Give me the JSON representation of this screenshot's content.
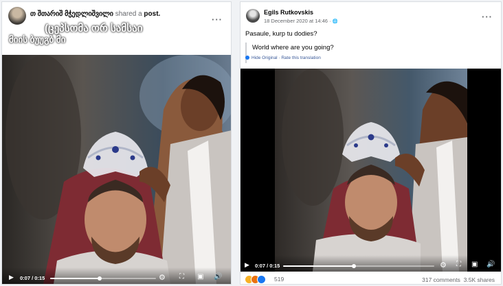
{
  "left_post": {
    "author": "თ  შთარიშ მჭედლიშვილი",
    "action": "shared a",
    "object": "post.",
    "overlay_line1": "(ცეპსომა ორ სამსაი",
    "overlay_line2": "მიის ბუუგბ მი"
  },
  "right_post": {
    "author": "Egils Rutkovskis",
    "timestamp": "18 December 2020 at 14:46 · ",
    "globe_icon": "🌐",
    "text": "Pasaule, kurp tu dodies?",
    "translation": "World where are you going?",
    "hide_original": "Hide Original",
    "separator": " · ",
    "rate_translation": "Rate this translation",
    "reaction_count": "519",
    "comments": "317 comments",
    "shares": "3.5K shares"
  },
  "video_left": {
    "time": "0:07 / 0:15",
    "progress": 0.47
  },
  "video_right": {
    "time": "0:07 / 0:15",
    "progress": 0.47
  },
  "icons": {
    "more": "···",
    "play": "▶",
    "settings": "⚙",
    "fullscreen": "⛶",
    "pip": "▣",
    "volume": "🔊"
  },
  "reaction_colors": {
    "haha": "#f7b125",
    "angry": "#e9710f",
    "like": "#1877f2"
  }
}
